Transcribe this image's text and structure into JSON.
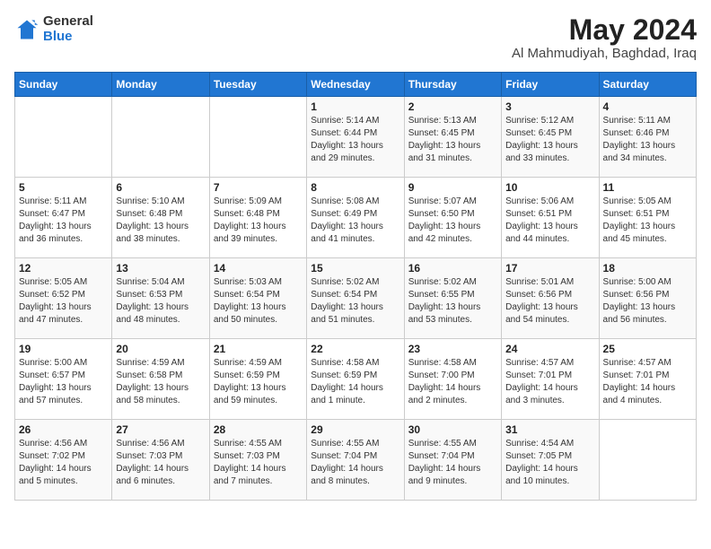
{
  "logo": {
    "general": "General",
    "blue": "Blue"
  },
  "title": {
    "month_year": "May 2024",
    "location": "Al Mahmudiyah, Baghdad, Iraq"
  },
  "days_of_week": [
    "Sunday",
    "Monday",
    "Tuesday",
    "Wednesday",
    "Thursday",
    "Friday",
    "Saturday"
  ],
  "weeks": [
    [
      {
        "day": "",
        "info": ""
      },
      {
        "day": "",
        "info": ""
      },
      {
        "day": "",
        "info": ""
      },
      {
        "day": "1",
        "info": "Sunrise: 5:14 AM\nSunset: 6:44 PM\nDaylight: 13 hours\nand 29 minutes."
      },
      {
        "day": "2",
        "info": "Sunrise: 5:13 AM\nSunset: 6:45 PM\nDaylight: 13 hours\nand 31 minutes."
      },
      {
        "day": "3",
        "info": "Sunrise: 5:12 AM\nSunset: 6:45 PM\nDaylight: 13 hours\nand 33 minutes."
      },
      {
        "day": "4",
        "info": "Sunrise: 5:11 AM\nSunset: 6:46 PM\nDaylight: 13 hours\nand 34 minutes."
      }
    ],
    [
      {
        "day": "5",
        "info": "Sunrise: 5:11 AM\nSunset: 6:47 PM\nDaylight: 13 hours\nand 36 minutes."
      },
      {
        "day": "6",
        "info": "Sunrise: 5:10 AM\nSunset: 6:48 PM\nDaylight: 13 hours\nand 38 minutes."
      },
      {
        "day": "7",
        "info": "Sunrise: 5:09 AM\nSunset: 6:48 PM\nDaylight: 13 hours\nand 39 minutes."
      },
      {
        "day": "8",
        "info": "Sunrise: 5:08 AM\nSunset: 6:49 PM\nDaylight: 13 hours\nand 41 minutes."
      },
      {
        "day": "9",
        "info": "Sunrise: 5:07 AM\nSunset: 6:50 PM\nDaylight: 13 hours\nand 42 minutes."
      },
      {
        "day": "10",
        "info": "Sunrise: 5:06 AM\nSunset: 6:51 PM\nDaylight: 13 hours\nand 44 minutes."
      },
      {
        "day": "11",
        "info": "Sunrise: 5:05 AM\nSunset: 6:51 PM\nDaylight: 13 hours\nand 45 minutes."
      }
    ],
    [
      {
        "day": "12",
        "info": "Sunrise: 5:05 AM\nSunset: 6:52 PM\nDaylight: 13 hours\nand 47 minutes."
      },
      {
        "day": "13",
        "info": "Sunrise: 5:04 AM\nSunset: 6:53 PM\nDaylight: 13 hours\nand 48 minutes."
      },
      {
        "day": "14",
        "info": "Sunrise: 5:03 AM\nSunset: 6:54 PM\nDaylight: 13 hours\nand 50 minutes."
      },
      {
        "day": "15",
        "info": "Sunrise: 5:02 AM\nSunset: 6:54 PM\nDaylight: 13 hours\nand 51 minutes."
      },
      {
        "day": "16",
        "info": "Sunrise: 5:02 AM\nSunset: 6:55 PM\nDaylight: 13 hours\nand 53 minutes."
      },
      {
        "day": "17",
        "info": "Sunrise: 5:01 AM\nSunset: 6:56 PM\nDaylight: 13 hours\nand 54 minutes."
      },
      {
        "day": "18",
        "info": "Sunrise: 5:00 AM\nSunset: 6:56 PM\nDaylight: 13 hours\nand 56 minutes."
      }
    ],
    [
      {
        "day": "19",
        "info": "Sunrise: 5:00 AM\nSunset: 6:57 PM\nDaylight: 13 hours\nand 57 minutes."
      },
      {
        "day": "20",
        "info": "Sunrise: 4:59 AM\nSunset: 6:58 PM\nDaylight: 13 hours\nand 58 minutes."
      },
      {
        "day": "21",
        "info": "Sunrise: 4:59 AM\nSunset: 6:59 PM\nDaylight: 13 hours\nand 59 minutes."
      },
      {
        "day": "22",
        "info": "Sunrise: 4:58 AM\nSunset: 6:59 PM\nDaylight: 14 hours\nand 1 minute."
      },
      {
        "day": "23",
        "info": "Sunrise: 4:58 AM\nSunset: 7:00 PM\nDaylight: 14 hours\nand 2 minutes."
      },
      {
        "day": "24",
        "info": "Sunrise: 4:57 AM\nSunset: 7:01 PM\nDaylight: 14 hours\nand 3 minutes."
      },
      {
        "day": "25",
        "info": "Sunrise: 4:57 AM\nSunset: 7:01 PM\nDaylight: 14 hours\nand 4 minutes."
      }
    ],
    [
      {
        "day": "26",
        "info": "Sunrise: 4:56 AM\nSunset: 7:02 PM\nDaylight: 14 hours\nand 5 minutes."
      },
      {
        "day": "27",
        "info": "Sunrise: 4:56 AM\nSunset: 7:03 PM\nDaylight: 14 hours\nand 6 minutes."
      },
      {
        "day": "28",
        "info": "Sunrise: 4:55 AM\nSunset: 7:03 PM\nDaylight: 14 hours\nand 7 minutes."
      },
      {
        "day": "29",
        "info": "Sunrise: 4:55 AM\nSunset: 7:04 PM\nDaylight: 14 hours\nand 8 minutes."
      },
      {
        "day": "30",
        "info": "Sunrise: 4:55 AM\nSunset: 7:04 PM\nDaylight: 14 hours\nand 9 minutes."
      },
      {
        "day": "31",
        "info": "Sunrise: 4:54 AM\nSunset: 7:05 PM\nDaylight: 14 hours\nand 10 minutes."
      },
      {
        "day": "",
        "info": ""
      }
    ]
  ]
}
